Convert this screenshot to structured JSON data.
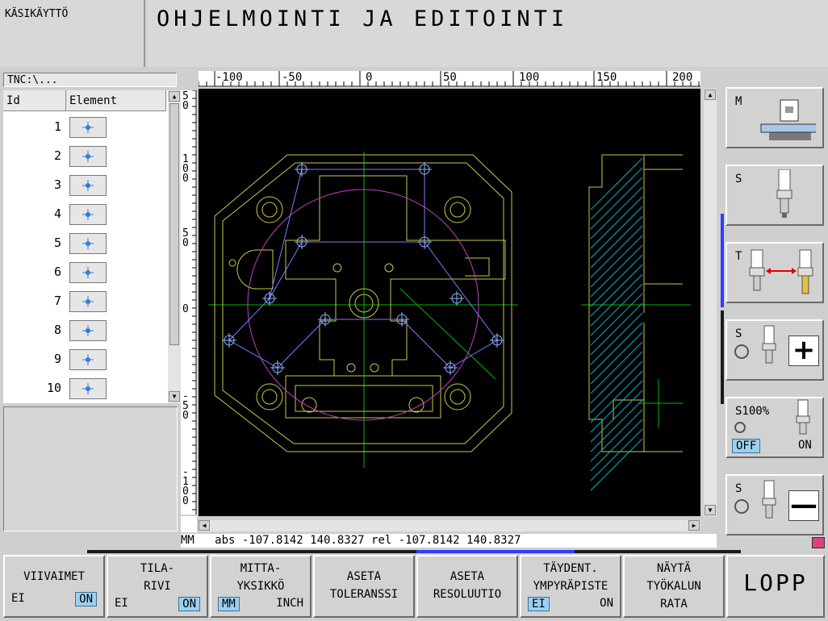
{
  "header": {
    "mode_left": "KÄSIKÄYTTÖ",
    "mode_right": "OHJELMOINTI JA EDITOINTI"
  },
  "file_path": "TNC:\\...",
  "list": {
    "col_id": "Id",
    "col_element": "Element",
    "rows": [
      {
        "id": "1",
        "icon": "point-icon"
      },
      {
        "id": "2",
        "icon": "point-icon"
      },
      {
        "id": "3",
        "icon": "point-icon"
      },
      {
        "id": "4",
        "icon": "point-icon"
      },
      {
        "id": "5",
        "icon": "point-icon"
      },
      {
        "id": "6",
        "icon": "point-icon"
      },
      {
        "id": "7",
        "icon": "point-icon"
      },
      {
        "id": "8",
        "icon": "point-icon"
      },
      {
        "id": "9",
        "icon": "point-icon"
      },
      {
        "id": "10",
        "icon": "point-icon"
      }
    ]
  },
  "ruler_top": [
    "-100",
    "-50",
    "0",
    "50",
    "100",
    "150",
    "200"
  ],
  "ruler_left": [
    "50",
    "100",
    "50",
    "0",
    "-50",
    "-100"
  ],
  "status": {
    "unit": "MM",
    "text": "abs -107.8142 140.8327 rel -107.8142 140.8327"
  },
  "softkeys": [
    {
      "lines": [
        "VIIVAIMET"
      ],
      "off": "EI",
      "on": "ON",
      "selected": "on"
    },
    {
      "lines": [
        "TILA-",
        "RIVI"
      ],
      "off": "EI",
      "on": "ON",
      "selected": "on"
    },
    {
      "lines": [
        "MITTA-",
        "YKSIKKÖ"
      ],
      "off": "MM",
      "on": "INCH",
      "selected": "off"
    },
    {
      "lines": [
        "ASETA",
        "TOLERANSSI"
      ]
    },
    {
      "lines": [
        "ASETA",
        "RESOLUUTIO"
      ]
    },
    {
      "lines": [
        "TÄYDENT.",
        "YMPYRÄPISTE"
      ],
      "off": "EI",
      "on": "ON",
      "selected": "off"
    },
    {
      "lines": [
        "NÄYTÄ",
        "TYÖKALUN",
        "RATA"
      ]
    },
    {
      "lines": [
        "LOPP"
      ]
    }
  ],
  "side": {
    "m": "M",
    "s1": "S",
    "t": "T",
    "s2": "S",
    "s3": "S100%",
    "s3_off": "OFF",
    "s3_on": "ON",
    "s4": "S",
    "plus": "+",
    "minus": "—"
  },
  "colors": {
    "canvas": "#000000",
    "contour": "#c8c84a",
    "axis": "#00c000",
    "circle": "#c040c0",
    "path": "#7c7cff",
    "hatch": "#00b0c0"
  }
}
